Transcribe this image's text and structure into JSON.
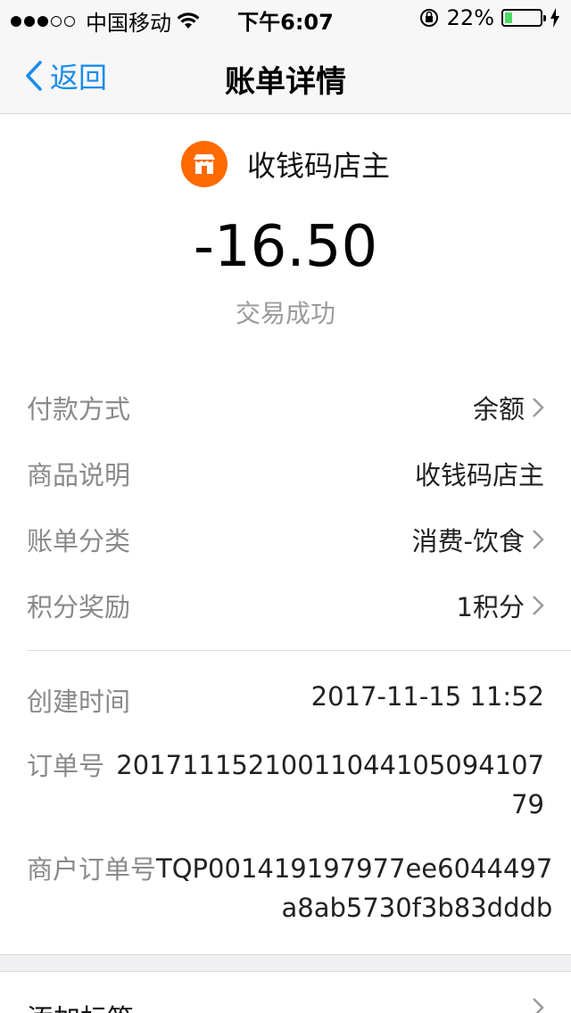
{
  "status_bar": {
    "carrier": "中国移动",
    "time": "下午6:07",
    "battery": "22%",
    "battery_level": 0.22,
    "battery_color": "#4cd964"
  },
  "nav": {
    "back_label": "返回",
    "title": "账单详情",
    "accent": "#1a8ceb"
  },
  "header": {
    "merchant_name": "收钱码店主",
    "icon": "shop-icon",
    "icon_color": "#ff6a00",
    "amount": "-16.50",
    "status": "交易成功"
  },
  "details": [
    {
      "label": "付款方式",
      "value": "余额",
      "chevron": true
    },
    {
      "label": "商品说明",
      "value": "收钱码店主",
      "chevron": false
    },
    {
      "label": "账单分类",
      "value": "消费-饮食",
      "chevron": true
    },
    {
      "label": "积分奖励",
      "value": "1积分",
      "chevron": true
    }
  ],
  "info": {
    "created_label": "创建时间",
    "created_value": "2017-11-15 11:52",
    "order_label": "订单号",
    "order_line1": "20171115210011044105094107",
    "order_line2": "79",
    "merchant_order_label": "商户订单号",
    "merchant_order_line1": "TQP001419197977ee6044497",
    "merchant_order_line2": "a8ab5730f3b83dddb"
  },
  "footer": {
    "tag_label": "添加标签"
  }
}
